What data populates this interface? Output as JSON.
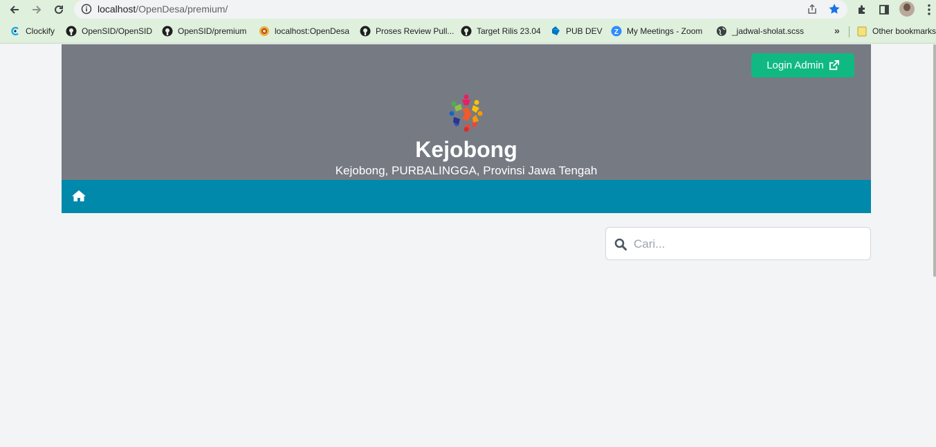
{
  "browser": {
    "url_host": "localhost",
    "url_path": "/OpenDesa/premium/",
    "bookmarks": [
      {
        "label": "Clockify",
        "icon": "clockify-icon"
      },
      {
        "label": "OpenSID/OpenSID",
        "icon": "github-icon"
      },
      {
        "label": "OpenSID/premium",
        "icon": "github-icon"
      },
      {
        "label": "localhost:OpenDesa",
        "icon": "opendesa-icon"
      },
      {
        "label": "Proses Review Pull...",
        "icon": "github-icon"
      },
      {
        "label": "Target Rilis 23.04",
        "icon": "github-icon"
      },
      {
        "label": "PUB DEV",
        "icon": "dart-icon"
      },
      {
        "label": "My Meetings - Zoom",
        "icon": "zoom-icon"
      },
      {
        "label": "_jadwal-sholat.scss",
        "icon": "globe-icon"
      }
    ],
    "more_label": "»",
    "other_bookmarks": "Other bookmarks"
  },
  "header": {
    "login_label": "Login Admin",
    "title": "Kejobong",
    "subtitle": "Kejobong, PURBALINGGA, Provinsi Jawa Tengah"
  },
  "search": {
    "placeholder": "Cari..."
  },
  "colors": {
    "header_bg": "#767b83",
    "navbar_bg": "#0089aa",
    "login_bg": "#10b981",
    "browser_bar": "#dff0dc"
  }
}
